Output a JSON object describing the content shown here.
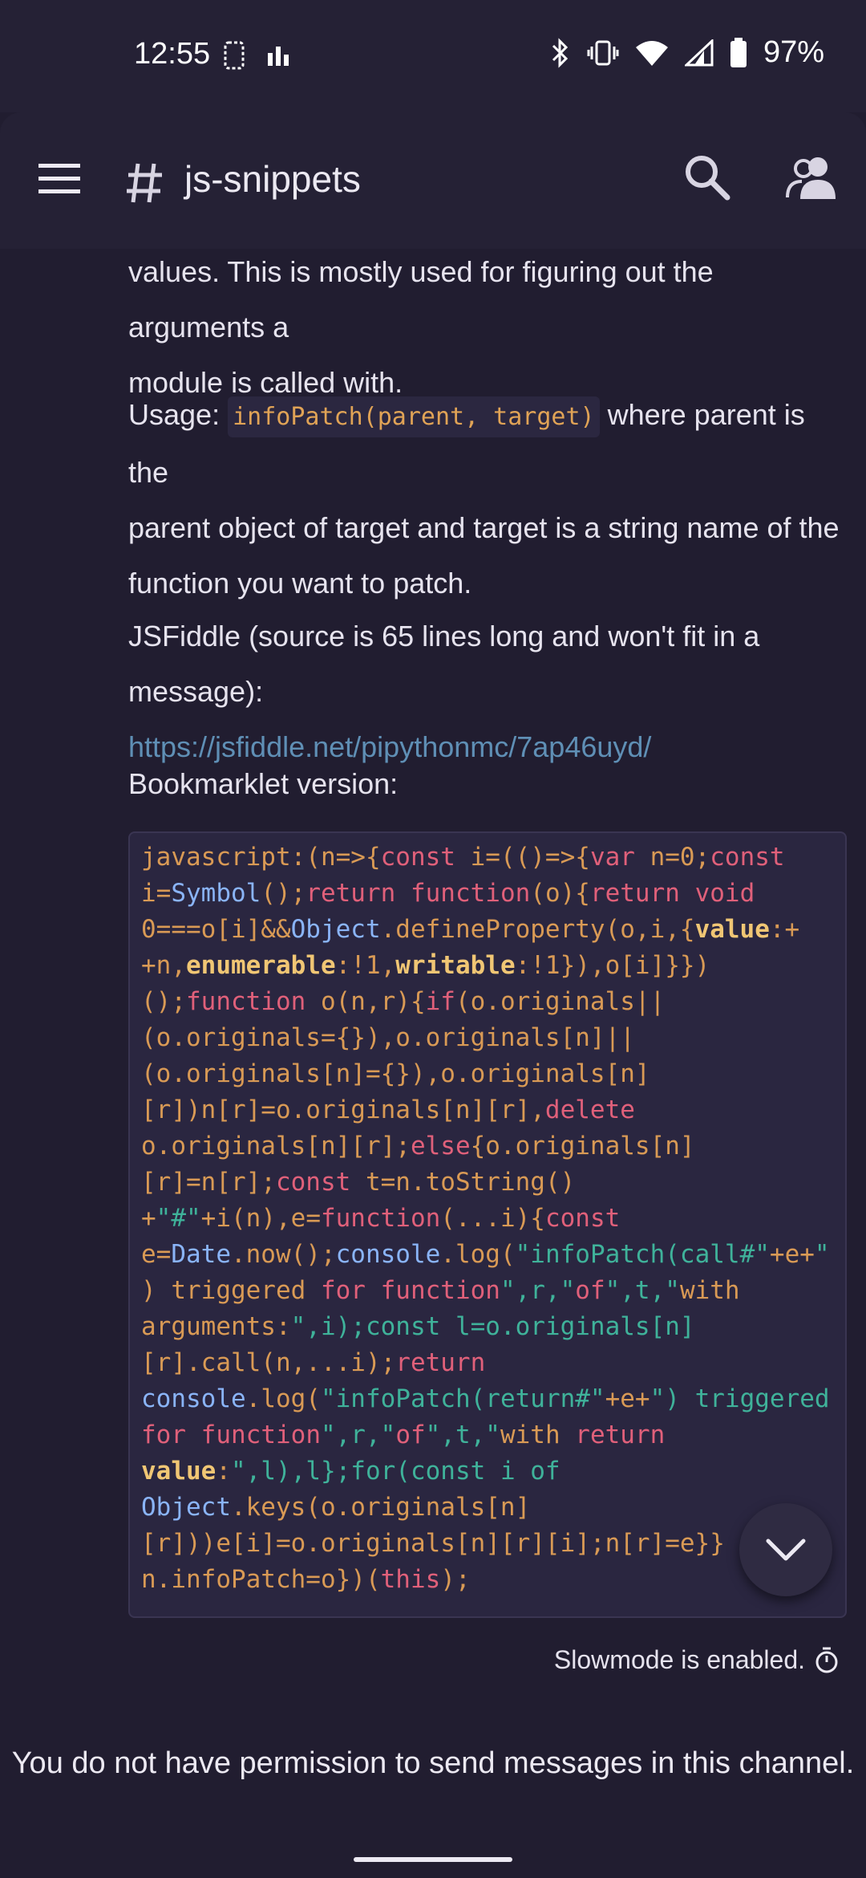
{
  "status_bar": {
    "time": "12:55",
    "battery": "97%",
    "icons": [
      "screen-record-icon",
      "signal-bars-icon",
      "bluetooth-icon",
      "vibrate-icon",
      "wifi-icon",
      "cell-signal-icon",
      "battery-icon"
    ]
  },
  "app_bar": {
    "channel_name": "js-snippets",
    "icons": [
      "menu-icon",
      "hash-icon",
      "search-icon",
      "members-icon"
    ]
  },
  "message": {
    "line1": "values. This is mostly used for figuring out the arguments a",
    "line2": "module is called with.",
    "usage_prefix": "Usage: ",
    "usage_code": "infoPatch(parent, target)",
    "usage_suffix1": " where parent is the",
    "usage_line2": "parent object of target and target is a string name of the",
    "usage_line3": "function you want to patch.",
    "jsfiddle_text": "JSFiddle (source is 65 lines long and won't fit in a message):",
    "jsfiddle_link": "https://jsfiddle.net/pipythonmc/7ap46uyd/",
    "bookmarklet_label": "Bookmarklet version:",
    "code": "javascript:(n=>{const i=(()=>{var n=0;const i=Symbol();return function(o){return void 0===o[i]&&Object.defineProperty(o,i,{value:++n,enumerable:!1,writable:!1}),o[i]}})();function o(n,r){if(o.originals||(o.originals={}),o.originals[n]||(o.originals[n]={}),o.originals[n][r])n[r]=o.originals[n][r],delete o.originals[n][r];else{o.originals[n][r]=n[r];const t=n.toString()+\"#\"+i(n),e=function(...i){const e=Date.now();console.log(\"infoPatch(call#\"+e+\") triggered for function\",r,\"of\",t,\"with arguments:\",i);const l=o.originals[n][r].call(n,...i);return console.log(\"infoPatch(return#\"+e+\") triggered for function\",r,\"of\",t,\"with return value:\",l),l};for(const i of Object.keys(o.originals[n][r]))e[i]=o.originals[n][r][i];n[r]=e}}n.infoPatch=o})(this);"
  },
  "slowmode_text": "Slowmode is enabled.",
  "no_permission_text": "You do not have permission to send messages in this channel."
}
